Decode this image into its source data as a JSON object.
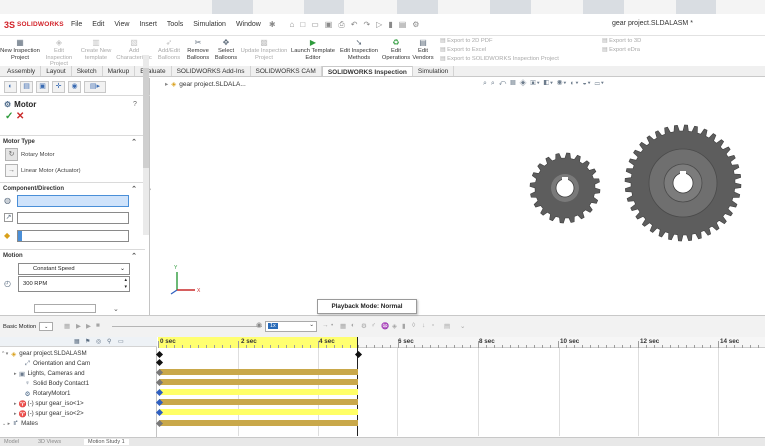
{
  "titlebar": {
    "logo_ds": "3S",
    "logo_text": "SOLIDWORKS",
    "menus": [
      "File",
      "Edit",
      "View",
      "Insert",
      "Tools",
      "Simulation",
      "Window"
    ],
    "document_title": "gear project.SLDALASM *"
  },
  "command_manager": {
    "buttons": [
      {
        "label": "New Inspection Project",
        "enabled": true,
        "icon": "new-inspection-icon"
      },
      {
        "label": "Edit Inspection Project",
        "enabled": false,
        "icon": "edit-inspection-icon"
      },
      {
        "label": "Create New template",
        "enabled": false,
        "icon": "template-icon"
      },
      {
        "label": "Add Characteristic",
        "enabled": false,
        "icon": "add-characteristic-icon"
      },
      {
        "label": "Add/Edit Balloons",
        "enabled": false,
        "icon": "balloon-icon"
      },
      {
        "label": "Remove Balloons",
        "enabled": true,
        "icon": "remove-balloon-icon"
      },
      {
        "label": "Select Balloons",
        "enabled": true,
        "icon": "select-balloon-icon"
      },
      {
        "label": "Update Inspection Project",
        "enabled": false,
        "icon": "update-icon"
      },
      {
        "label": "Launch Template Editor",
        "enabled": true,
        "icon": "launch-icon"
      },
      {
        "label": "Edit Inspection Methods",
        "enabled": true,
        "icon": "methods-icon"
      },
      {
        "label": "Edit Operations",
        "enabled": true,
        "icon": "operations-icon"
      },
      {
        "label": "Edit Vendors",
        "enabled": true,
        "icon": "vendors-icon"
      }
    ],
    "exports": [
      "Export to 2D PDF",
      "Export to Excel",
      "Export to SOLIDWORKS Inspection Project",
      "Export to 3D",
      "Export eDra"
    ]
  },
  "tabs": [
    "Assembly",
    "Layout",
    "Sketch",
    "Markup",
    "Evaluate",
    "SOLIDWORKS Add-Ins",
    "SOLIDWORKS CAM",
    "SOLIDWORKS Inspection",
    "Simulation"
  ],
  "active_tab": "SOLIDWORKS Inspection",
  "property_manager": {
    "title": "Motor",
    "help": "?",
    "ok": "✓",
    "cancel": "✕",
    "motor_type": {
      "header": "Motor Type",
      "options": [
        "Rotary Motor",
        "Linear Motor (Actuator)"
      ]
    },
    "component_direction": {
      "header": "Component/Direction"
    },
    "motion": {
      "header": "Motion",
      "function": "Constant Speed",
      "speed": "300 RPM"
    }
  },
  "viewport": {
    "tree_label": "gear project.SLDALA...",
    "axis_y": "Y",
    "axis_x": "X"
  },
  "motion_toolbar": {
    "study_type": "Basic Motion",
    "tooltip": "Playback Mode: Normal",
    "speed": "1x"
  },
  "motion_tree": [
    {
      "label": "gear project.SLDALASM",
      "icon": "assembly-icon",
      "indent": 0
    },
    {
      "label": "Orientation and Cam",
      "icon": "orientation-icon",
      "indent": 2
    },
    {
      "label": "Lights, Cameras and",
      "icon": "lights-icon",
      "indent": 1
    },
    {
      "label": "Solid Body Contact1",
      "icon": "contact-icon",
      "indent": 2
    },
    {
      "label": "RotaryMotor1",
      "icon": "motor-icon",
      "indent": 2
    },
    {
      "label": "(-) spur gear_iso<1>",
      "icon": "part-icon",
      "indent": 1
    },
    {
      "label": "(-) spur gear_iso<2>",
      "icon": "part-icon",
      "indent": 1
    },
    {
      "label": "Mates",
      "icon": "mates-icon",
      "indent": 1
    }
  ],
  "timeline": {
    "labels": [
      "0 sec",
      "2 sec",
      "4 sec",
      "6 sec",
      "8 sec",
      "10 sec",
      "12 sec",
      "14 sec"
    ]
  },
  "bottom_tabs": [
    "Model",
    "3D Views",
    "Motion Study 1"
  ],
  "colors": {
    "accent": "#d2232a",
    "gear": "#6a6a6a",
    "timeline_bar": "#c9a84a",
    "timeline_highlight": "#ffff70"
  }
}
